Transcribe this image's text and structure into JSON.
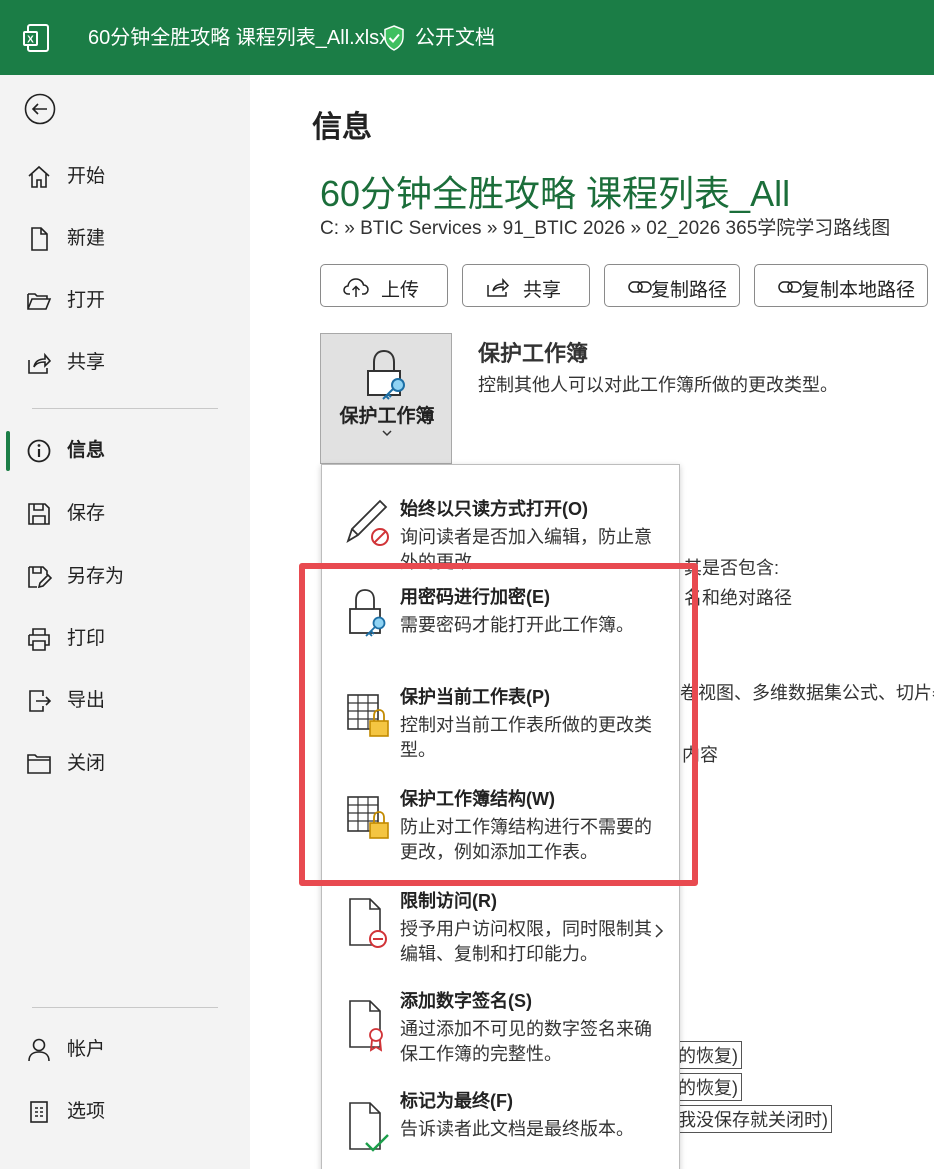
{
  "titlebar": {
    "title": "60分钟全胜攻略 课程列表_All.xlsx",
    "badge": "公开文档",
    "app_icon": "excel-icon",
    "badge_icon": "shield-check-icon",
    "bg_color": "#1b7d46"
  },
  "sidebar": {
    "items": [
      {
        "label": "开始",
        "icon": "home-icon"
      },
      {
        "label": "新建",
        "icon": "new-document-icon"
      },
      {
        "label": "打开",
        "icon": "folder-open-icon"
      },
      {
        "label": "共享",
        "icon": "share-icon"
      },
      {
        "label": "信息",
        "icon": "info-icon",
        "active": true
      },
      {
        "label": "保存",
        "icon": "save-icon"
      },
      {
        "label": "另存为",
        "icon": "save-as-icon"
      },
      {
        "label": "打印",
        "icon": "print-icon"
      },
      {
        "label": "导出",
        "icon": "export-icon"
      },
      {
        "label": "关闭",
        "icon": "close-folder-icon"
      }
    ],
    "bottom_items": [
      {
        "label": "帐户",
        "icon": "person-icon"
      },
      {
        "label": "选项",
        "icon": "options-icon"
      }
    ]
  },
  "main": {
    "page_title": "信息",
    "doc_title": "60分钟全胜攻略 课程列表_All",
    "doc_path": "C: » BTIC Services » 91_BTIC 2026 » 02_2026 365学院学习路线图",
    "actions": [
      {
        "label": "上传",
        "icon": "upload-icon"
      },
      {
        "label": "共享",
        "icon": "share-icon"
      },
      {
        "label": "复制路径",
        "icon": "link-icon"
      },
      {
        "label": "复制本地路径",
        "icon": "link-icon"
      }
    ],
    "protect": {
      "tile_label": "保护工作簿",
      "heading": "保护工作簿",
      "description": "控制其他人可以对此工作簿所做的更改类型。"
    },
    "background_fragments": {
      "line1": "其是否包含:",
      "line2": "名和绝对路径",
      "line3": "卷视图、多维数据集公式、切片器",
      "line4": "内容",
      "box1": "的恢复)",
      "box2": "的恢复)",
      "box3": "我没保存就关闭时)"
    }
  },
  "dropdown": {
    "items": [
      {
        "title": "始终以只读方式打开(O)",
        "desc": "询问读者是否加入编辑，防止意外的更改。",
        "icon": "pencil-prohibited-icon"
      },
      {
        "title": "用密码进行加密(E)",
        "desc": "需要密码才能打开此工作簿。",
        "icon": "lock-key-icon"
      },
      {
        "title": "保护当前工作表(P)",
        "desc": "控制对当前工作表所做的更改类型。",
        "icon": "sheet-lock-icon"
      },
      {
        "title": "保护工作簿结构(W)",
        "desc": "防止对工作簿结构进行不需要的更改，例如添加工作表。",
        "icon": "workbook-lock-icon"
      },
      {
        "title": "限制访问(R)",
        "desc": "授予用户访问权限，同时限制其编辑、复制和打印能力。",
        "icon": "document-restrict-icon",
        "has_submenu": true
      },
      {
        "title": "添加数字签名(S)",
        "desc": "通过添加不可见的数字签名来确保工作簿的完整性。",
        "icon": "document-ribbon-icon"
      },
      {
        "title": "标记为最终(F)",
        "desc": "告诉读者此文档是最终版本。",
        "icon": "document-check-icon"
      }
    ]
  },
  "highlight_color": "#e84a50"
}
